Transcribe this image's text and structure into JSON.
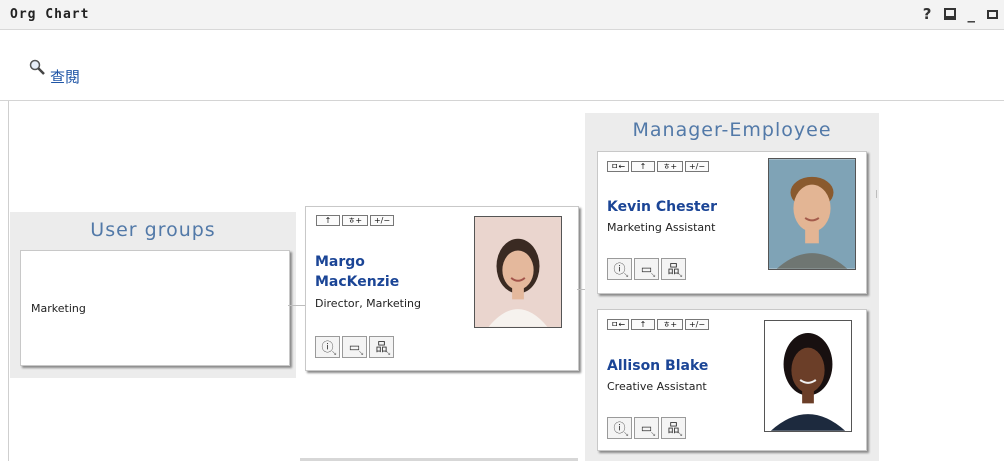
{
  "window": {
    "title": "Org Chart",
    "controls": {
      "help": "?",
      "print_icon": "printer-icon",
      "minimize": "_",
      "maximize_icon": "maximize-icon"
    }
  },
  "lookup": {
    "icon": "magnifier-icon",
    "label": "查閱"
  },
  "user_groups": {
    "title": "User groups",
    "items": [
      "Marketing"
    ]
  },
  "focus": {
    "name_line1": "Margo",
    "name_line2": "MacKenzie",
    "role": "Director, Marketing",
    "mini_buttons": [
      "↑",
      "ㅎ+",
      "+/−"
    ]
  },
  "manager_employee": {
    "title": "Manager-Employee",
    "employees": [
      {
        "name": "Kevin Chester",
        "role": "Marketing Assistant",
        "mini_buttons": [
          "ㅁ←",
          "↑",
          "ㅎ+",
          "+/−"
        ]
      },
      {
        "name": "Allison Blake",
        "role": "Creative Assistant",
        "mini_buttons": [
          "ㅁ←",
          "↑",
          "ㅎ+",
          "+/−"
        ]
      }
    ]
  },
  "action_buttons": [
    "info-icon",
    "email-icon",
    "org-icon"
  ],
  "colors": {
    "accent": "#5279a8",
    "name": "#1b4596",
    "link": "#1f55a6",
    "panel_bg": "#ececec"
  }
}
